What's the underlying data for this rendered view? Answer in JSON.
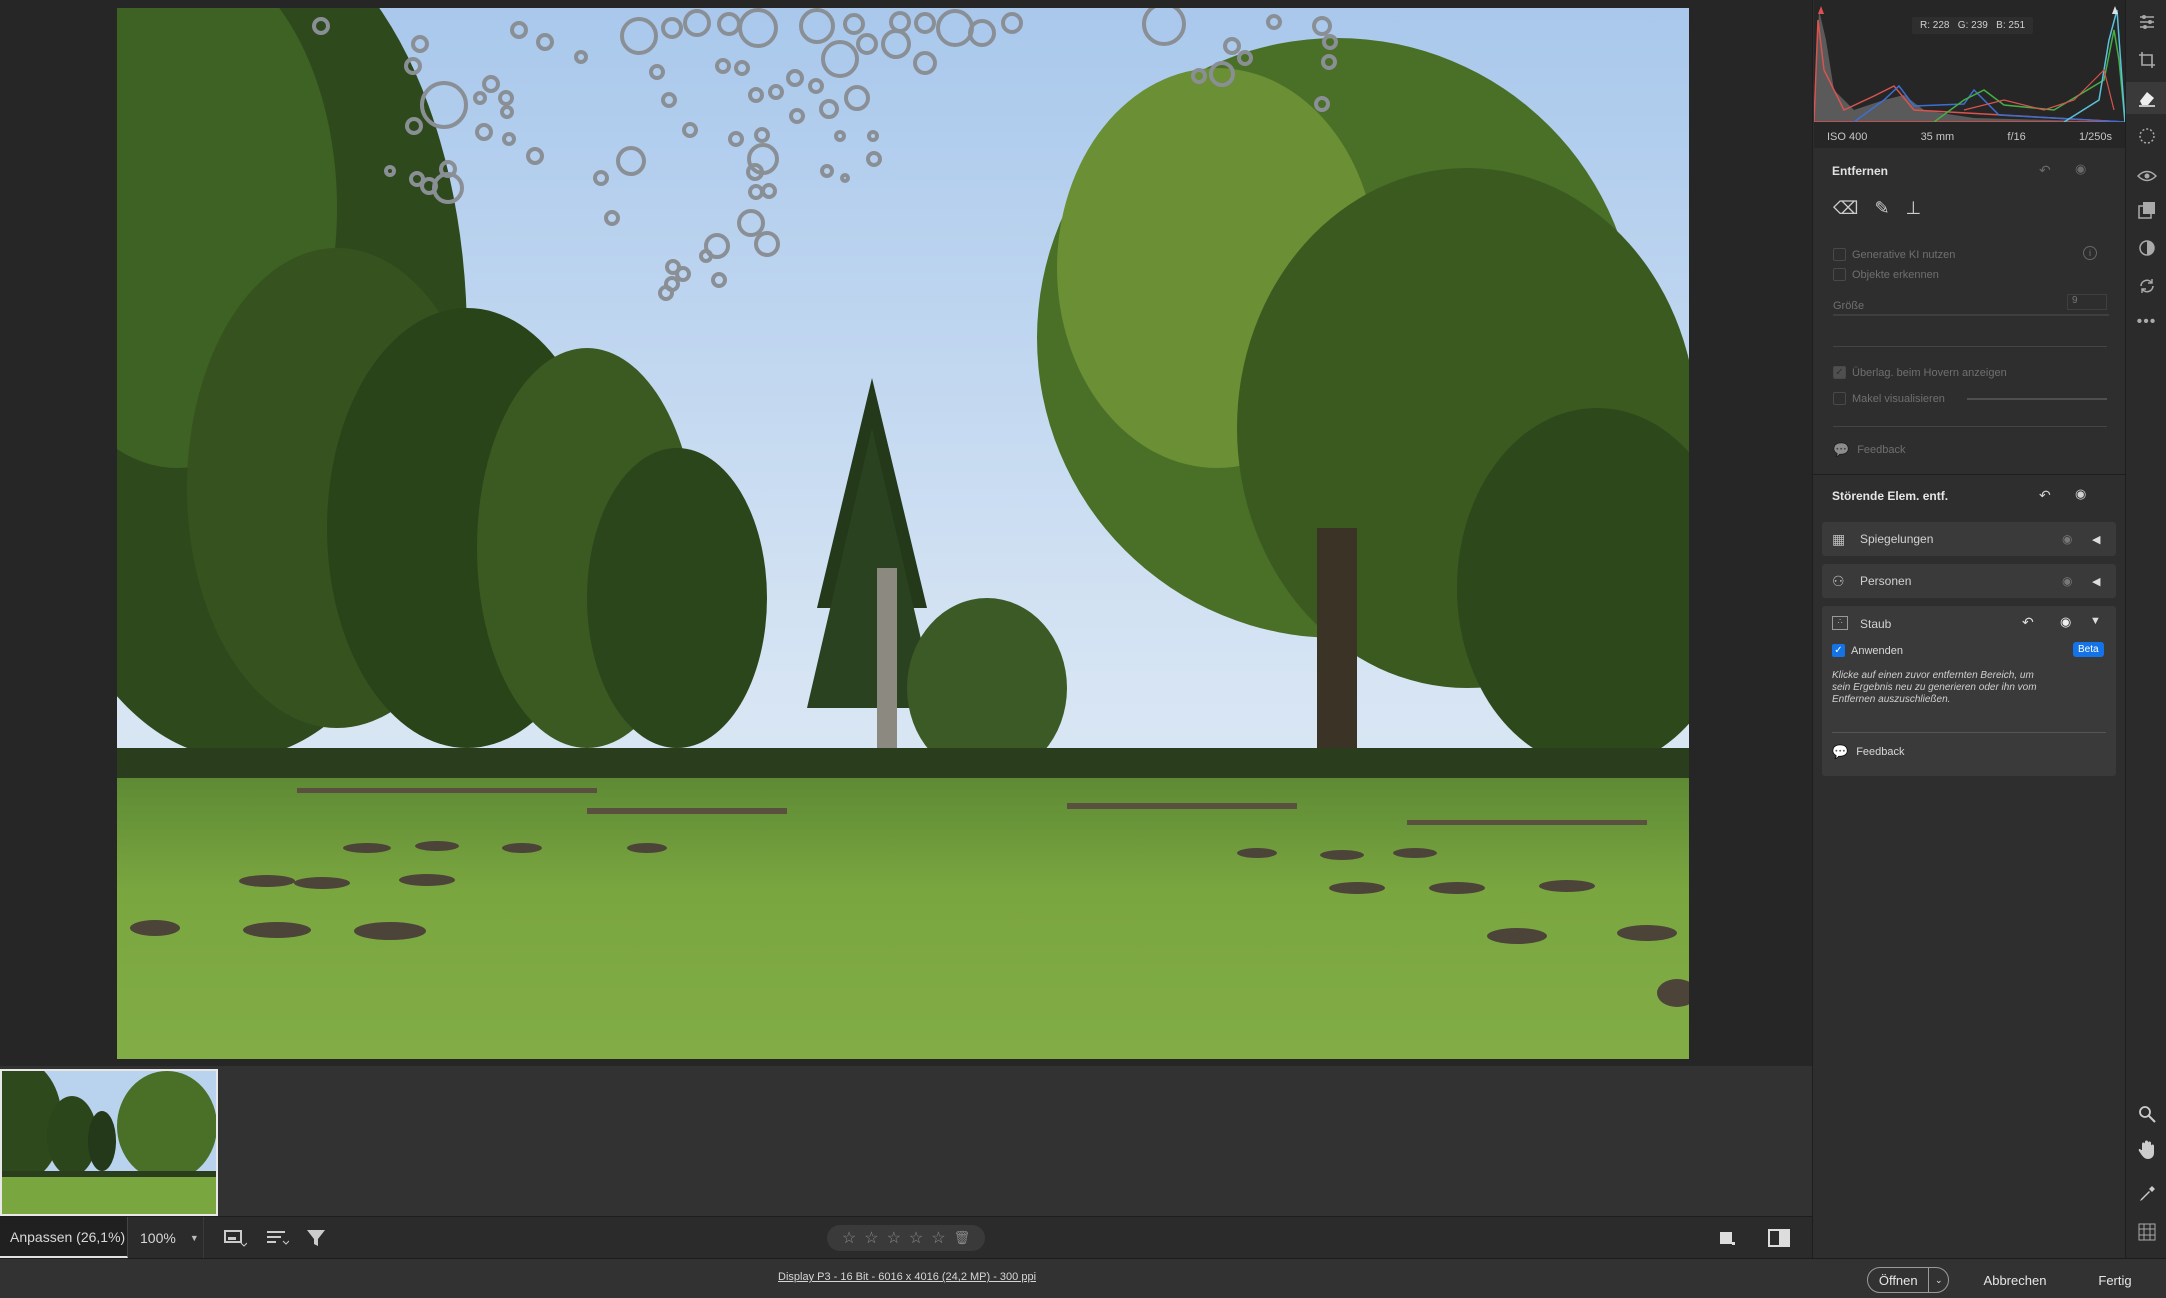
{
  "histogram": {
    "rgb_readout": "R: 228   G: 239   B: 251",
    "iso": "ISO 400",
    "focal": "35 mm",
    "aperture": "f/16",
    "shutter": "1/250s"
  },
  "remove": {
    "title": "Entfernen",
    "generative_ai": "Generative KI nutzen",
    "detect_objects": "Objekte erkennen",
    "size_label": "Größe",
    "size_value": "9",
    "overlay_hover": "Überlag. beim Hovern anzeigen",
    "visualize_spots": "Makel visualisieren",
    "feedback": "Feedback"
  },
  "distractions": {
    "title": "Störende Elem. entf.",
    "items": [
      {
        "label": "Spiegelungen"
      },
      {
        "label": "Personen"
      },
      {
        "label": "Staub"
      }
    ],
    "apply_label": "Anwenden",
    "beta": "Beta",
    "hint": "Klicke auf einen zuvor entfernten Bereich, um sein Ergebnis neu zu generieren oder ihn vom Entfernen auszuschließen.",
    "feedback": "Feedback"
  },
  "viewbar": {
    "fit": "Anpassen (26,1%)",
    "zoom": "100%"
  },
  "status": {
    "file_info": "Display P3 - 16 Bit - 6016 x 4016 (24,2 MP) - 300 ppi"
  },
  "buttons": {
    "open": "Öffnen",
    "cancel": "Abbrechen",
    "done": "Fertig"
  },
  "colors": {
    "accent": "#1473e6",
    "panel": "#2e2e2e",
    "row": "#3a3a3a"
  }
}
